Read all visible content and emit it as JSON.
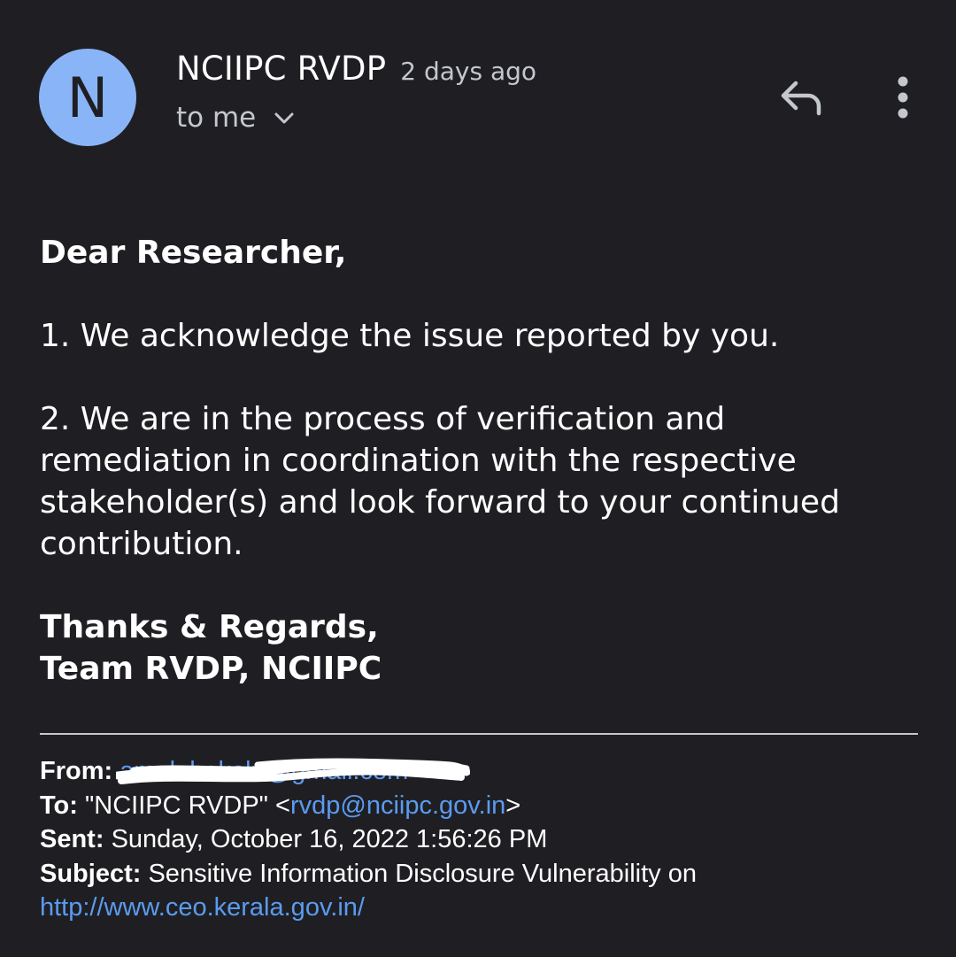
{
  "header": {
    "avatar_letter": "N",
    "sender_name": "NCIIPC RVDP",
    "sent_time": "2 days ago",
    "to_label": "to me",
    "icons": {
      "reply": "reply-icon",
      "more": "more-vert-icon",
      "expand": "chevron-down-icon"
    }
  },
  "body": {
    "greeting": "Dear Researcher,",
    "paragraph1": "1. We acknowledge the issue reported by you.",
    "paragraph2": "2. We are in the process of verification and remediation in coordination with the respective stakeholder(s) and look forward to your continued contribution.",
    "signoff": "Thanks & Regards,",
    "team": "Team RVDP, NCIIPC"
  },
  "quoted": {
    "from_label": "From:",
    "from_value": "amolehakolu@gmail.com",
    "to_label": "To:",
    "to_name": "\"NCIIPC RVDP\" <",
    "to_email": "rvdp@nciipc.gov.in",
    "to_close": ">",
    "sent_label": "Sent:",
    "sent_value": "Sunday, October 16, 2022 1:56:26 PM",
    "subject_label": "Subject:",
    "subject_value": "Sensitive Information Disclosure Vulnerability on",
    "subject_link": "http://www.ceo.kerala.gov.in/"
  },
  "colors": {
    "background": "#1f1f23",
    "avatar": "#8ab4f8",
    "link": "#5b9bf0",
    "secondary_text": "#c4c7cc"
  }
}
